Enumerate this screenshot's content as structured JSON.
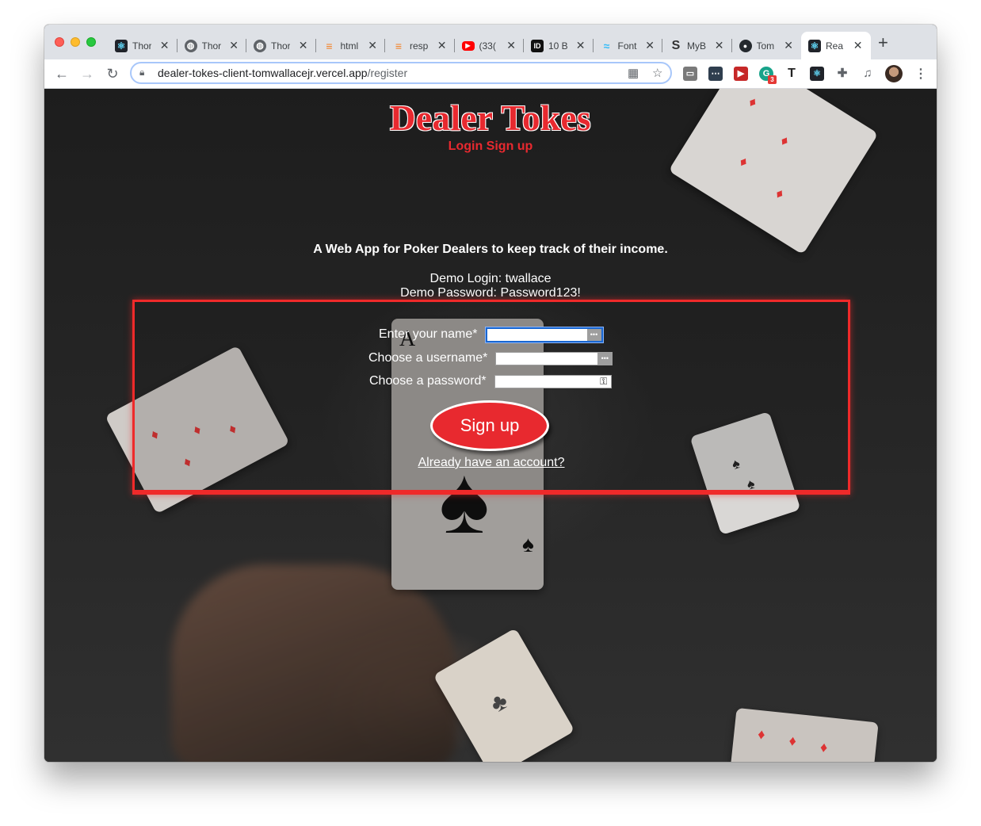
{
  "browser": {
    "tabs": [
      {
        "icon": "react-icon",
        "title": "Thor"
      },
      {
        "icon": "globe-icon",
        "title": "Thor"
      },
      {
        "icon": "globe-icon",
        "title": "Thor"
      },
      {
        "icon": "stackoverflow-icon",
        "title": "html"
      },
      {
        "icon": "stackoverflow-icon",
        "title": "resp"
      },
      {
        "icon": "youtube-icon",
        "title": "(33("
      },
      {
        "icon": "id-icon",
        "title": "10 B"
      },
      {
        "icon": "tailwind-icon",
        "title": "Font"
      },
      {
        "icon": "s-icon",
        "title": "MyB"
      },
      {
        "icon": "github-icon",
        "title": "Tom"
      },
      {
        "icon": "react-icon",
        "title": "Rea",
        "active": true
      }
    ],
    "url_host": "dealer-tokes-client-tomwallacejr.vercel.app",
    "url_path": "/register",
    "extension_badge": "3"
  },
  "page": {
    "brand": "Dealer Tokes",
    "nav": {
      "login": "Login",
      "signup": "Sign up"
    },
    "tagline": "A Web App for Poker Dealers to keep track of their income.",
    "demo_login": "Demo Login: twallace",
    "demo_password": "Demo Password: Password123!",
    "form": {
      "name_label": "Enter your name*",
      "username_label": "Choose a username*",
      "password_label": "Choose a password*",
      "name_value": "",
      "username_value": "",
      "password_value": "",
      "submit_label": "Sign up",
      "already_link": "Already have an account?"
    }
  },
  "colors": {
    "brand_red": "#e8292f",
    "form_border": "#ef2a2a",
    "focus_blue": "#1967d2"
  }
}
